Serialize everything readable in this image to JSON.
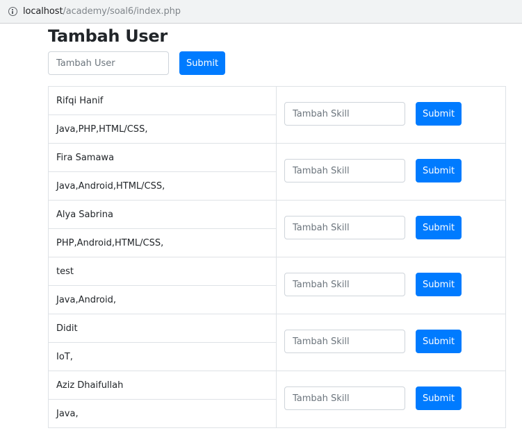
{
  "browser": {
    "url_host": "localhost",
    "url_path": "/academy/soal6/index.php"
  },
  "page": {
    "title": "Tambah User",
    "add_user": {
      "placeholder": "Tambah User",
      "submit_label": "Submit"
    }
  },
  "users": [
    {
      "name": "Rifqi Hanif",
      "skills": "Java,PHP,HTML/CSS,",
      "skill_placeholder": "Tambah Skill",
      "submit_label": "Submit"
    },
    {
      "name": "Fira Samawa",
      "skills": "Java,Android,HTML/CSS,",
      "skill_placeholder": "Tambah Skill",
      "submit_label": "Submit"
    },
    {
      "name": "Alya Sabrina",
      "skills": "PHP,Android,HTML/CSS,",
      "skill_placeholder": "Tambah Skill",
      "submit_label": "Submit"
    },
    {
      "name": "test",
      "skills": "Java,Android,",
      "skill_placeholder": "Tambah Skill",
      "submit_label": "Submit"
    },
    {
      "name": "Didit",
      "skills": "IoT,",
      "skill_placeholder": "Tambah Skill",
      "submit_label": "Submit"
    },
    {
      "name": "Aziz Dhaifullah",
      "skills": "Java,",
      "skill_placeholder": "Tambah Skill",
      "submit_label": "Submit"
    }
  ],
  "colors": {
    "primary": "#007bff",
    "border": "#dee2e6",
    "addressbar_bg": "#f1f3f4"
  },
  "icons": {
    "address_bar": "info-icon"
  }
}
